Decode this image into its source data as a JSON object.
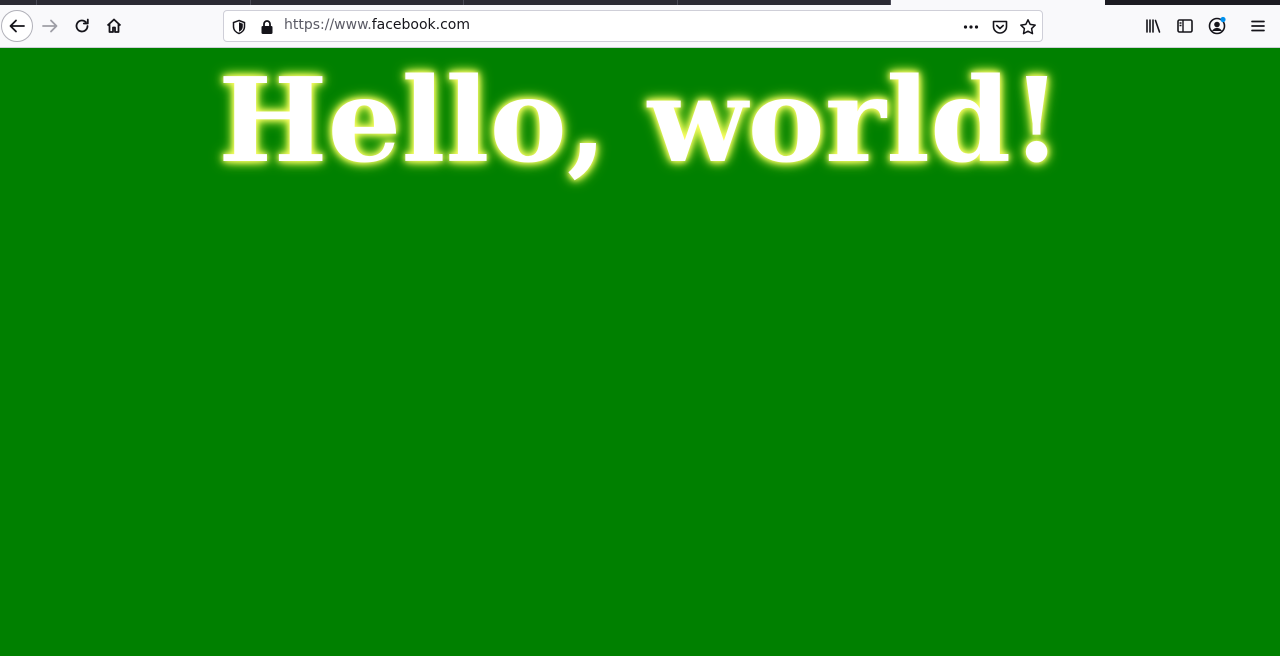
{
  "browser": {
    "url_prefix": "https://www.",
    "url_host": "facebook.com",
    "url_suffix": ".com",
    "icons": {
      "back": "back-arrow-icon",
      "forward": "forward-arrow-icon",
      "reload": "reload-icon",
      "home": "home-icon",
      "tracking_shield": "shield-icon",
      "lock": "lock-icon",
      "page_actions": "more-dots-icon",
      "pocket": "pocket-icon",
      "bookmark": "star-icon",
      "library": "library-icon",
      "sidebar": "sidebar-icon",
      "account": "account-icon",
      "menu": "hamburger-menu-icon"
    },
    "colors": {
      "toolbar": "#f9f9fb",
      "tabstrip": "#1c1b22",
      "account_badge": "#0090ed"
    }
  },
  "page": {
    "heading": "Hello, world!",
    "background_color": "#008000",
    "heading_color": "#ffffff",
    "glow_color": "#ffff66"
  }
}
